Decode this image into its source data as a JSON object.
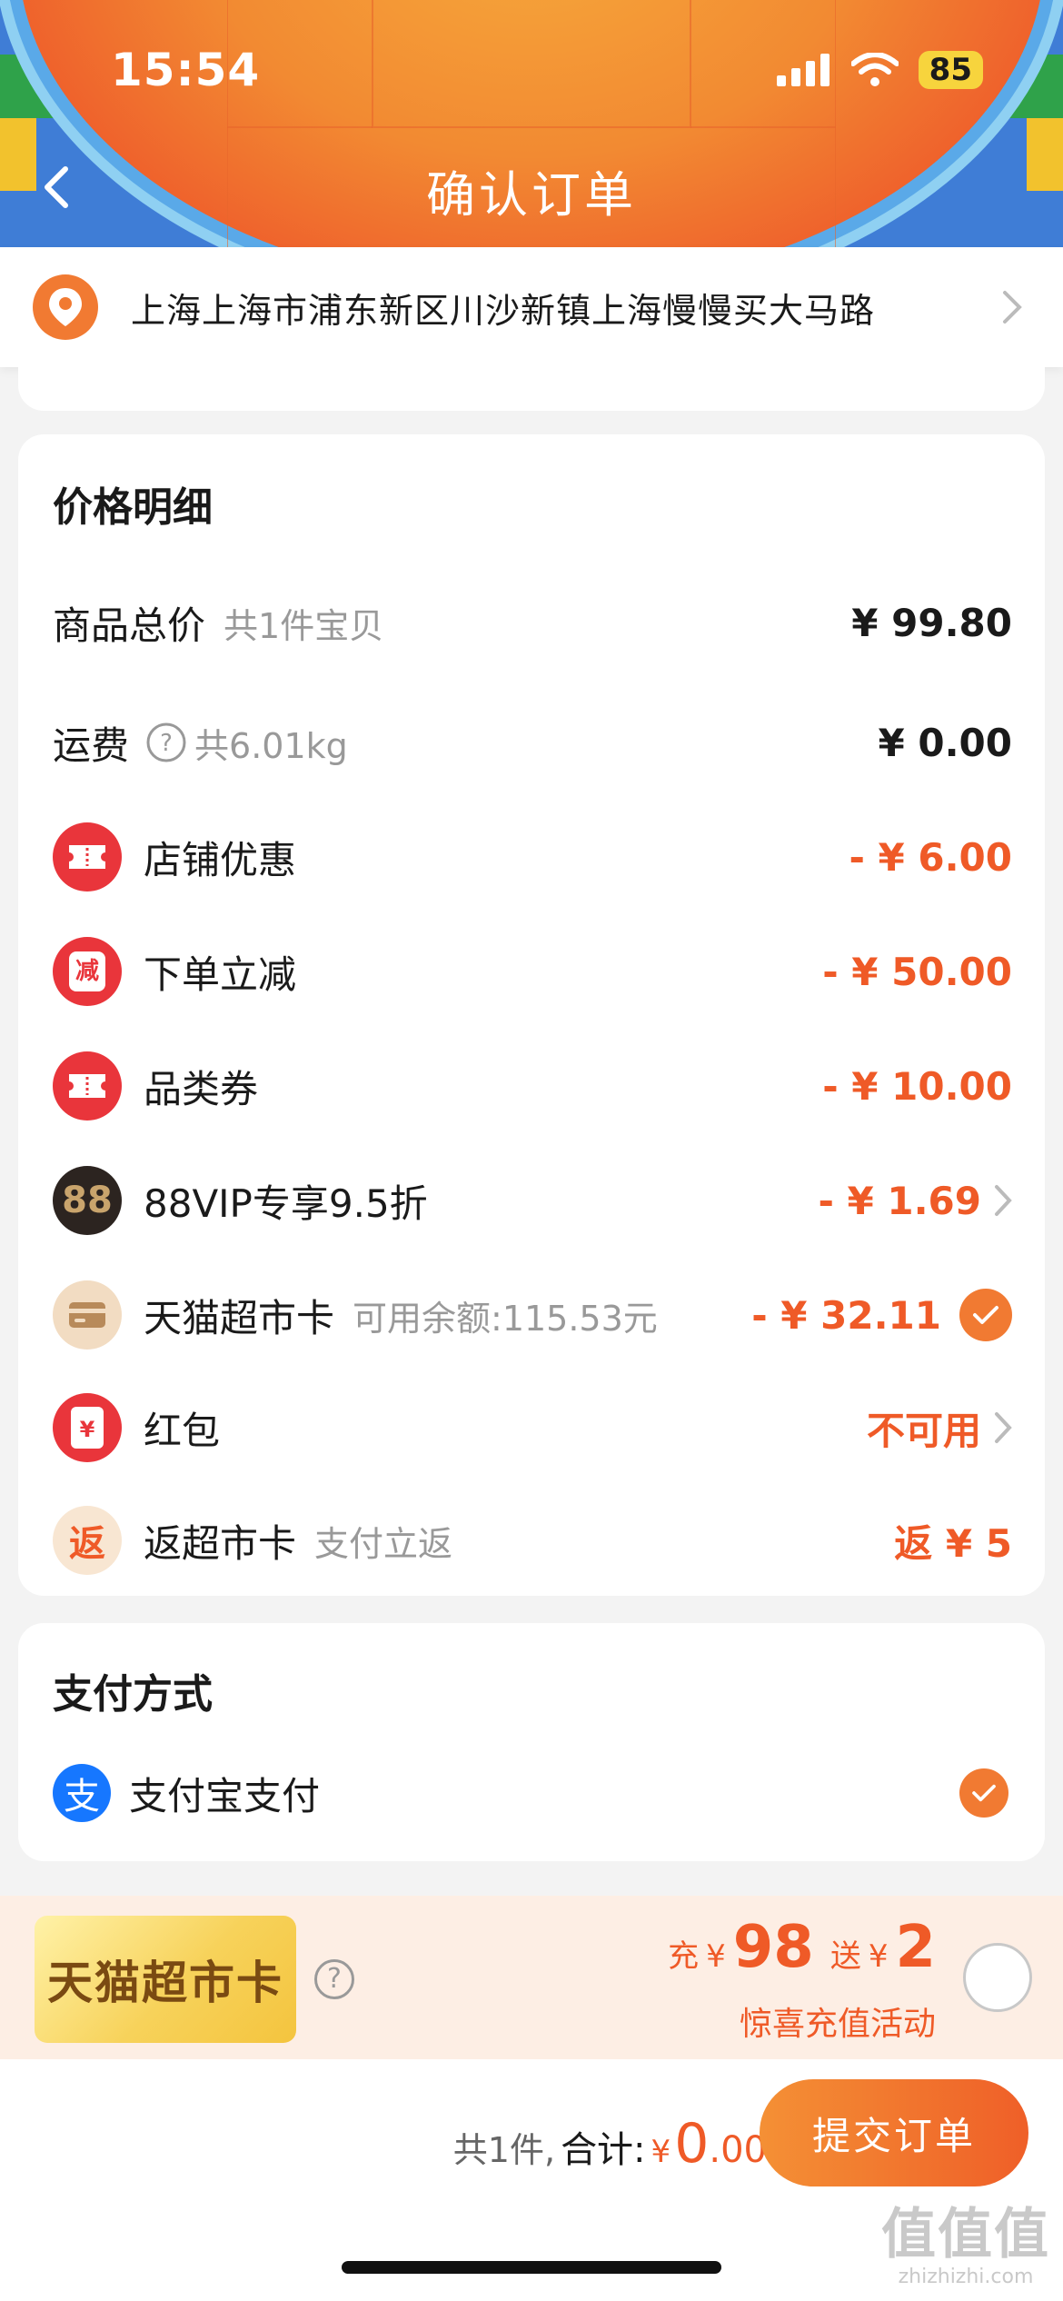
{
  "status_bar": {
    "time": "15:54",
    "battery": "85"
  },
  "nav": {
    "title": "确认订单"
  },
  "address": {
    "text": "上海上海市浦东新区川沙新镇上海慢慢买大马路"
  },
  "price_detail": {
    "title": "价格明细",
    "rows": [
      {
        "label": "商品总价",
        "sub": "共1件宝贝",
        "amount": "¥ 99.80"
      },
      {
        "label": "运费",
        "sub": "共6.01kg",
        "amount": "¥ 0.00"
      },
      {
        "label": "店铺优惠",
        "amount": "- ¥ 6.00",
        "icon": "ticket-icon"
      },
      {
        "label": "下单立减",
        "amount": "- ¥ 50.00",
        "icon": "discount-jar-icon",
        "icon_text": "减"
      },
      {
        "label": "品类券",
        "amount": "- ¥ 10.00",
        "icon": "ticket-icon"
      },
      {
        "label": "88VIP专享9.5折",
        "amount": "- ¥ 1.69",
        "icon": "vip88-icon",
        "icon_text": "88"
      },
      {
        "label": "天猫超市卡",
        "sub": "可用余额:115.53元",
        "amount": "- ¥ 32.11",
        "icon": "card-icon"
      },
      {
        "label": "红包",
        "amount": "不可用",
        "icon": "red-envelope-icon",
        "icon_text": "¥"
      },
      {
        "label": "返超市卡",
        "sub": "支付立返",
        "amount": "返 ¥ 5",
        "icon": "fan-icon",
        "icon_text": "返"
      }
    ]
  },
  "payment": {
    "title": "支付方式",
    "method": "支付宝支付",
    "icon_text": "支"
  },
  "promo": {
    "card_label": "天猫超市卡",
    "charge_prefix": "充",
    "currency": "¥",
    "charge_amount": "98",
    "gift_prefix": "送",
    "gift_amount": "2",
    "subtitle": "惊喜充值活动"
  },
  "bottom": {
    "count": "共1件,",
    "total_label": "合计:",
    "currency": "¥",
    "total_int": "0",
    "total_dec": ".00",
    "submit": "提交订单"
  },
  "watermark": {
    "big": "值值值",
    "small": "zhizhizhi.com"
  },
  "colors": {
    "accent": "#ef5a27",
    "orange_btn": "#f17a32",
    "alipay": "#1677ff"
  }
}
